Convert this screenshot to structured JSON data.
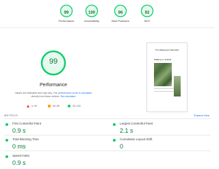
{
  "summary": {
    "gauges": [
      {
        "score": "99",
        "label": "Performance"
      },
      {
        "score": "100",
        "label": "Accessibility"
      },
      {
        "score": "96",
        "label": "Best Practices"
      },
      {
        "score": "92",
        "label": "SEO"
      }
    ]
  },
  "performance": {
    "score": "99",
    "score_fraction": 0.99,
    "title": "Performance",
    "note_prefix": "Values are estimated and may vary. The",
    "note_link": "performance score is calculated",
    "note_middle": "directly from these metrics.",
    "note_calc_link": "See calculator",
    "legend": [
      {
        "range": "0–49"
      },
      {
        "range": "50–89"
      },
      {
        "range": "90–100"
      }
    ]
  },
  "screenshot": {
    "title": "The Ridgewood Naturalist",
    "subtitle": "Walking on asphalt"
  },
  "metrics": {
    "header": "METRICS",
    "expand_label": "Expand view",
    "items": [
      {
        "label": "First Contentful Paint",
        "value": "0.9 s"
      },
      {
        "label": "Largest Contentful Paint",
        "value": "2.1 s"
      },
      {
        "label": "Total Blocking Time",
        "value": "0 ms"
      },
      {
        "label": "Cumulative Layout Shift",
        "value": "0"
      },
      {
        "label": "Speed Index",
        "value": "0.9 s"
      }
    ]
  },
  "colors": {
    "pass": "#0cce6b",
    "pass_text": "#0c7a35",
    "average": "#ffa400",
    "fail": "#e53935",
    "link": "#1a73e8"
  }
}
